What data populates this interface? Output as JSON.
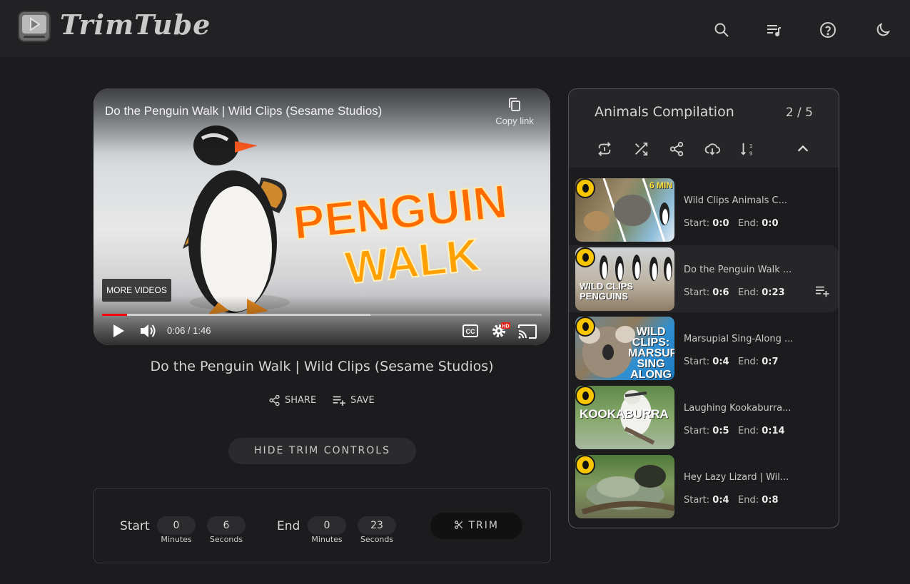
{
  "header": {
    "brand": "TrimTube",
    "icons": [
      "search-icon",
      "queue-music-icon",
      "help-icon",
      "dark-mode-icon"
    ]
  },
  "player": {
    "title": "Do the Penguin Walk | Wild Clips (Sesame Studios)",
    "copy_link_label": "Copy link",
    "overlay_text_1": "PENGUIN",
    "overlay_text_2": "WALK",
    "more_videos_label": "MORE VIDEOS",
    "time_display": "0:06 / 1:46",
    "played_fraction": 0.057,
    "buffered_fraction": 0.61,
    "hd_badge": "HD",
    "cc_label": "CC"
  },
  "video": {
    "heading": "Do the Penguin Walk | Wild Clips (Sesame Studios)",
    "share_label": "SHARE",
    "save_label": "SAVE"
  },
  "trim": {
    "toggle_label": "HIDE TRIM CONTROLS",
    "start_label": "Start",
    "end_label": "End",
    "start_minutes": "0",
    "start_seconds": "6",
    "end_minutes": "0",
    "end_seconds": "23",
    "minutes_label": "Minutes",
    "seconds_label": "Seconds",
    "trim_button_label": "TRIM"
  },
  "playlist": {
    "title": "Animals Compilation",
    "position": "2 / 5",
    "start_label": "Start:",
    "end_label": "End:",
    "items": [
      {
        "name": "Wild Clips Animals C...",
        "start": "0:0",
        "end": "0:0",
        "thumb_caption": "6 MIN"
      },
      {
        "name": "Do the Penguin Walk ...",
        "start": "0:6",
        "end": "0:23",
        "thumb_caption": "WILD CLIPS PENGUINS"
      },
      {
        "name": "Marsupial Sing-Along ...",
        "start": "0:4",
        "end": "0:7",
        "thumb_caption": "WILD CLIPS: MARSUPIAL SING ALONG"
      },
      {
        "name": "Laughing Kookaburra...",
        "start": "0:5",
        "end": "0:14",
        "thumb_caption": "KOOKABURRA"
      },
      {
        "name": "Hey Lazy Lizard | Wil...",
        "start": "0:4",
        "end": "0:8",
        "thumb_caption": ""
      }
    ]
  },
  "colors": {
    "background": "#1c1c1e",
    "header": "#222224",
    "progress_played": "#ff0000",
    "badge_yellow": "#f7c600"
  }
}
